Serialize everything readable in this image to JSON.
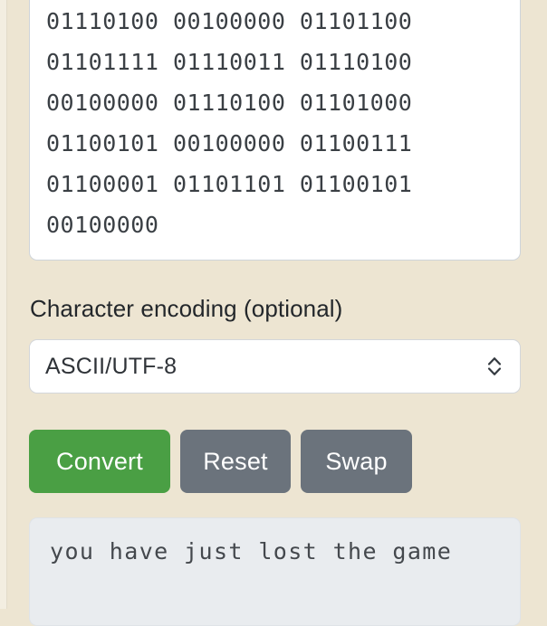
{
  "colors": {
    "page_background": "#ede5d2",
    "convert_button": "#4a9f44",
    "secondary_button": "#6b737c",
    "output_background": "#e9ecef",
    "input_background": "#ffffff"
  },
  "binary_input": {
    "lines": [
      "01110100 00100000 01101100",
      "01101111 01110011 01110100",
      "00100000 01110100 01101000",
      "01100101 00100000 01100111",
      "01100001 01101101 01100101",
      "00100000"
    ],
    "value": "01110100 00100000 01101100 01101111 01110011 01110100 00100000 01110100 01101000 01100101 00100000 01100111 01100001 01101101 01100101 00100000",
    "placeholder": ""
  },
  "encoding": {
    "label": "Character encoding (optional)",
    "selected": "ASCII/UTF-8",
    "chevron_icon": "chevron-up-down-icon"
  },
  "buttons": {
    "convert": "Convert",
    "reset": "Reset",
    "swap": "Swap"
  },
  "output": {
    "text": "you have just lost the game"
  }
}
